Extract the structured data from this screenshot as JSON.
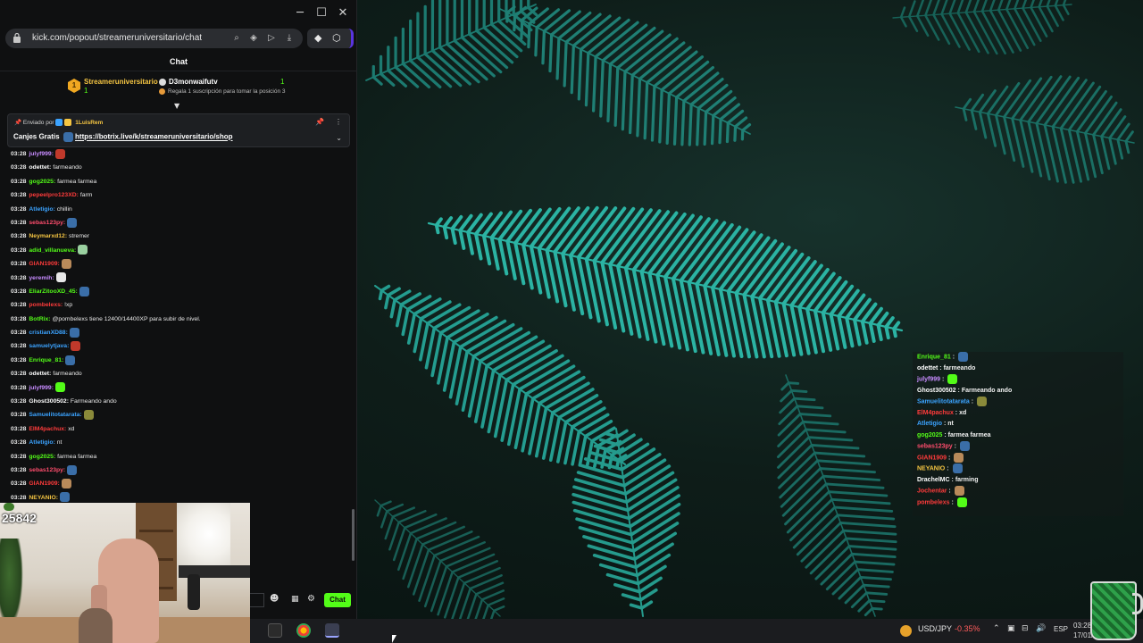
{
  "browser": {
    "url": "kick.com/popout/streameruniversitario/chat",
    "window_controls": [
      "minimize",
      "maximize",
      "close"
    ]
  },
  "chat": {
    "title": "Chat",
    "leaderboard": {
      "rank": "1",
      "first_name": "Streameruniversitario",
      "first_subs": "1",
      "second_name": "D3monwaifutv",
      "second_subs": "1",
      "note": "Regala 1 suscripción para tomar la posición 3"
    },
    "pinned": {
      "sent_by_label": "Enviado por",
      "sender": "1LuisRem",
      "message_prefix": "Canjes Gratis",
      "link": "https://botrix.live/k/streameruniversitario/shop"
    },
    "messages": [
      {
        "time": "03:28",
        "user": "julyf999:",
        "color": "#c78bff",
        "text": "",
        "emote": "#c0392b"
      },
      {
        "time": "03:28",
        "user": "odettet:",
        "color": "#ffffff",
        "text": "farmeando",
        "emote": ""
      },
      {
        "time": "03:28",
        "user": "gog2025:",
        "color": "#53fc18",
        "text": "farmea farmea",
        "emote": ""
      },
      {
        "time": "03:28",
        "user": "pepeelpro123XD:",
        "color": "#ff3b3b",
        "text": "farm",
        "emote": ""
      },
      {
        "time": "03:28",
        "user": "Atletigio:",
        "color": "#3ba3ff",
        "text": "chillin",
        "emote": ""
      },
      {
        "time": "03:28",
        "user": "sebas123py:",
        "color": "#ff4d6d",
        "text": "",
        "emote": "#3a6ea8"
      },
      {
        "time": "03:28",
        "user": "Neymarxd12:",
        "color": "#f5c542",
        "text": "stremer",
        "emote": ""
      },
      {
        "time": "03:28",
        "user": "adid_villanueva:",
        "color": "#53fc18",
        "text": "",
        "emote": "#9ad0a0"
      },
      {
        "time": "03:28",
        "user": "GIAN1909:",
        "color": "#ff3b3b",
        "text": "",
        "emote": "#b88a5a"
      },
      {
        "time": "03:28",
        "user": "yeremih:",
        "color": "#c78bff",
        "text": "",
        "emote": "#e8e8e8"
      },
      {
        "time": "03:28",
        "user": "EliarZitooXD_45:",
        "color": "#53fc18",
        "text": "",
        "emote": "#3a6ea8"
      },
      {
        "time": "03:28",
        "user": "pombelexs:",
        "color": "#ff3b3b",
        "text": "!xp",
        "emote": ""
      },
      {
        "time": "03:28",
        "user": "BotRix:",
        "color": "#53fc18",
        "text": "@pombelexs tiene 12400/14400XP para subir de nivel.",
        "emote": ""
      },
      {
        "time": "03:28",
        "user": "cristianXD88:",
        "color": "#3ba3ff",
        "text": "",
        "emote": "#3a6ea8"
      },
      {
        "time": "03:28",
        "user": "samuelytjava:",
        "color": "#3ba3ff",
        "text": "",
        "emote": "#c0392b"
      },
      {
        "time": "03:28",
        "user": "Enrique_81:",
        "color": "#53fc18",
        "text": "",
        "emote": "#3a6ea8"
      },
      {
        "time": "03:28",
        "user": "odettet:",
        "color": "#ffffff",
        "text": "farmeando",
        "emote": ""
      },
      {
        "time": "03:28",
        "user": "julyf999:",
        "color": "#c78bff",
        "text": "",
        "emote": "#53fc18"
      },
      {
        "time": "03:28",
        "user": "Ghost300502:",
        "color": "#ffffff",
        "text": "Farmeando ando",
        "emote": ""
      },
      {
        "time": "03:28",
        "user": "Samuelitotatarata:",
        "color": "#3ba3ff",
        "text": "",
        "emote": "#8a8a3a"
      },
      {
        "time": "03:28",
        "user": "ElM4pachux:",
        "color": "#ff3b3b",
        "text": "xd",
        "emote": ""
      },
      {
        "time": "03:28",
        "user": "Atletigio:",
        "color": "#3ba3ff",
        "text": "nt",
        "emote": ""
      },
      {
        "time": "03:28",
        "user": "gog2025:",
        "color": "#53fc18",
        "text": "farmea farmea",
        "emote": ""
      },
      {
        "time": "03:28",
        "user": "sebas123py:",
        "color": "#ff4d6d",
        "text": "",
        "emote": "#3a6ea8"
      },
      {
        "time": "03:28",
        "user": "GIAN1909:",
        "color": "#ff3b3b",
        "text": "",
        "emote": "#b88a5a"
      },
      {
        "time": "03:28",
        "user": "NEYANIO:",
        "color": "#f5c542",
        "text": "",
        "emote": "#3a6ea8"
      }
    ],
    "send_label": "Chat"
  },
  "stream": {
    "viewer_count": "25842"
  },
  "overlay_chat": [
    {
      "user": "Enrique_81",
      "color": "#53fc18",
      "text": "",
      "emote": "#3a6ea8"
    },
    {
      "user": "odettet",
      "color": "#ffffff",
      "text": "farmeando",
      "emote": ""
    },
    {
      "user": "julyf999",
      "color": "#c78bff",
      "text": "",
      "emote": "#53fc18"
    },
    {
      "user": "Ghost300502",
      "color": "#ffffff",
      "text": "Farmeando ando",
      "emote": ""
    },
    {
      "user": "Samuelitotatarata",
      "color": "#3ba3ff",
      "text": "",
      "emote": "#8a8a3a"
    },
    {
      "user": "ElM4pachux",
      "color": "#ff3b3b",
      "text": "xd",
      "emote": ""
    },
    {
      "user": "Atletigio",
      "color": "#3ba3ff",
      "text": "nt",
      "emote": ""
    },
    {
      "user": "gog2025",
      "color": "#53fc18",
      "text": "farmea farmea",
      "emote": ""
    },
    {
      "user": "sebas123py",
      "color": "#ff4d6d",
      "text": "",
      "emote": "#3a6ea8"
    },
    {
      "user": "GIAN1909",
      "color": "#ff3b3b",
      "text": "",
      "emote": "#b88a5a"
    },
    {
      "user": "NEYANIO",
      "color": "#f5c542",
      "text": "",
      "emote": "#3a6ea8"
    },
    {
      "user": "DrachelMC",
      "color": "#ffffff",
      "text": "farming",
      "emote": ""
    },
    {
      "user": "Jochentar",
      "color": "#ff3b3b",
      "text": "",
      "emote": "#b88a5a"
    },
    {
      "user": "pombelexs",
      "color": "#ff3b3b",
      "text": "",
      "emote": "#53fc18"
    }
  ],
  "taskbar": {
    "ticker_symbol": "USD/JPY",
    "ticker_change": "-0.35%",
    "language": "ESP",
    "time": "03:28",
    "date": "17/01/"
  },
  "colors": {
    "kick_green": "#53fc18",
    "accent_purple": "#5a34e0"
  }
}
